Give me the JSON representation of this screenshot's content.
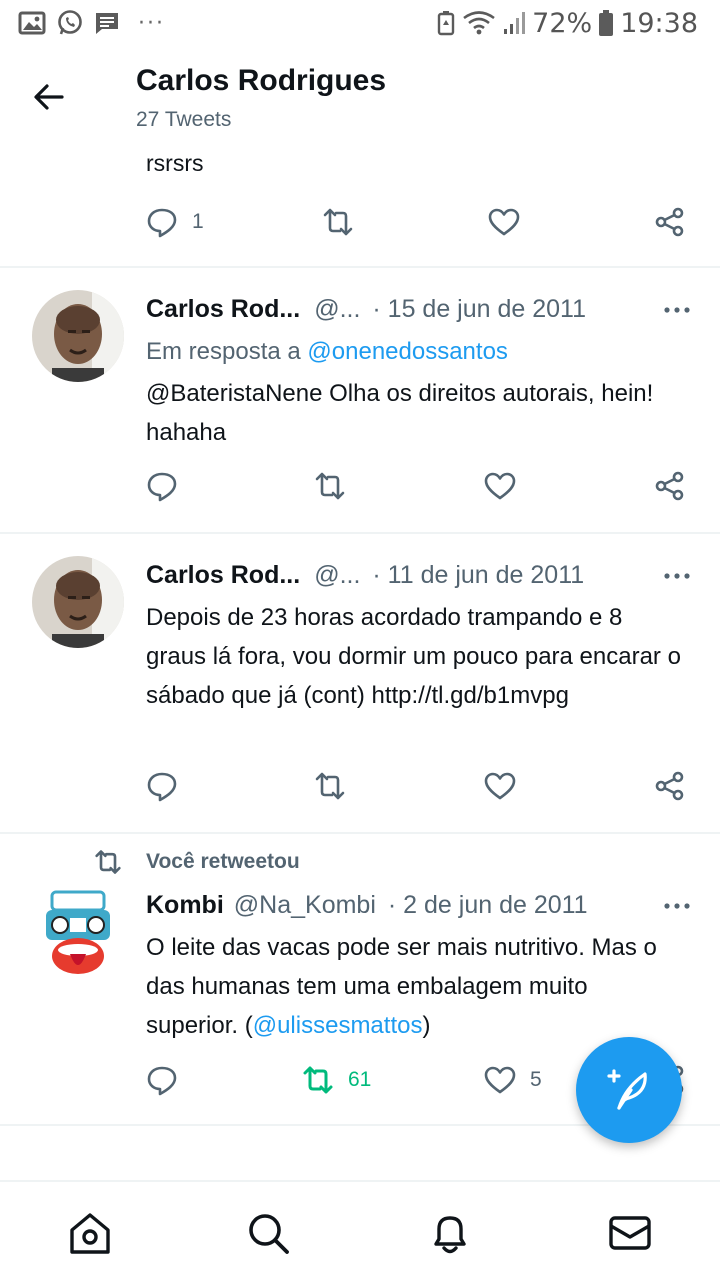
{
  "status_bar": {
    "battery": "72%",
    "time": "19:38",
    "overflow_dots": "···"
  },
  "header": {
    "title": "Carlos Rodrigues",
    "subtitle": "27 Tweets"
  },
  "partial_tweet": {
    "text": "rsrsrs",
    "reply_count": "1"
  },
  "tweets": [
    {
      "name": "Carlos Rod...",
      "handle": "@...",
      "date": "· 15 de jun de 2011",
      "reply_prefix": "Em resposta a",
      "reply_to": "@onenedossantos",
      "text": "@BateristaNene Olha os direitos autorais, hein! hahaha"
    },
    {
      "name": "Carlos Rod...",
      "handle": "@...",
      "date": "· 11 de jun de 2011",
      "text": "Depois de 23 horas acordado trampando e 8 graus lá fora, vou dormir um pouco para encarar o sábado que já (cont) http://tl.gd/b1mvpg"
    },
    {
      "retweet_label": "Você retweetou",
      "name": "Kombi",
      "handle": "@Na_Kombi",
      "date": "· 2 de jun de 2011",
      "text_part1": "O leite das vacas pode ser mais nutritivo. Mas o das humanas tem uma embalagem muito superior. (",
      "mention": "@ulissesmattos",
      "text_part2": ")",
      "retweet_count": "61",
      "like_count": "5"
    }
  ],
  "colors": {
    "accent": "#1d9bf0",
    "text": "#0f1419",
    "secondary": "#536471",
    "retweet_green": "#00ba7c",
    "divider": "#eff3f4"
  },
  "icons": [
    "back-arrow-icon",
    "reply-icon",
    "retweet-icon",
    "like-icon",
    "share-icon",
    "more-icon",
    "compose-icon",
    "home-icon",
    "search-icon",
    "notifications-icon",
    "messages-icon"
  ]
}
